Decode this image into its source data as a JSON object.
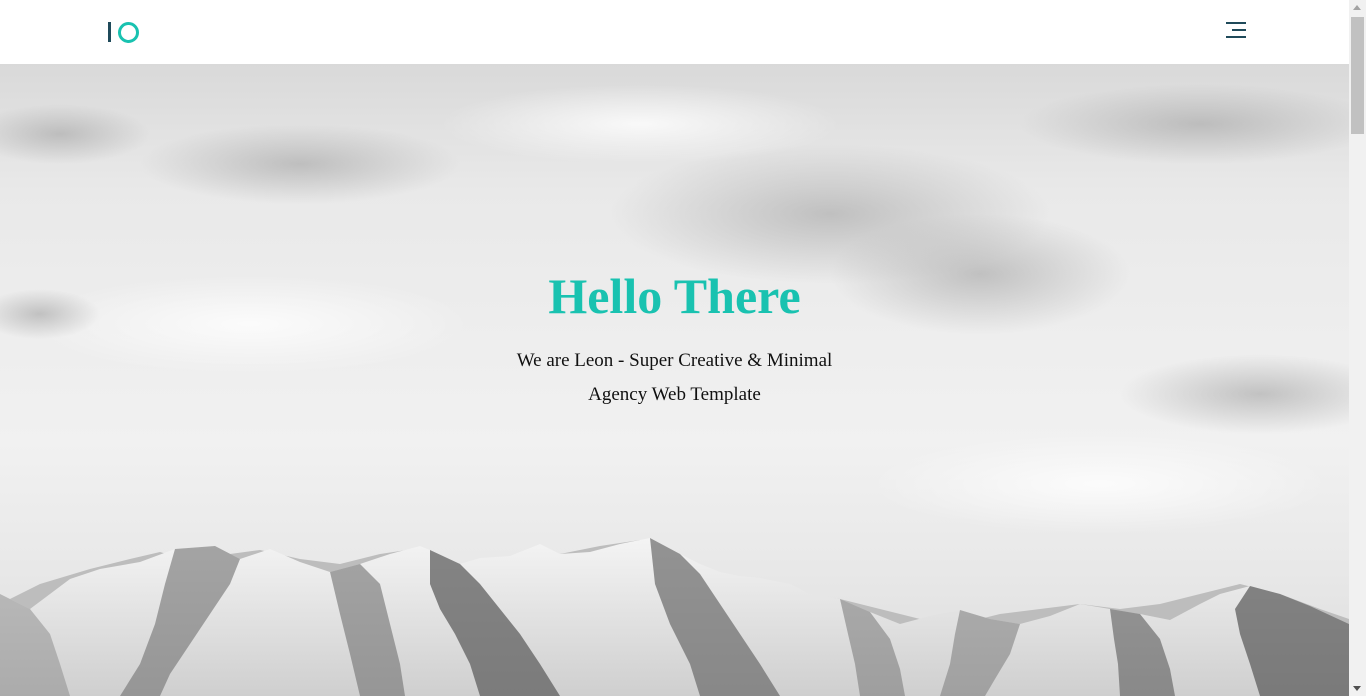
{
  "header": {
    "logo_icon": "io-logo-icon",
    "menu_icon": "hamburger-menu-icon"
  },
  "hero": {
    "title": "Hello There",
    "subtitle_line1": "We are Leon - Super Creative & Minimal",
    "subtitle_line2": "Agency Web Template",
    "background": "mountain-landscape-image"
  },
  "colors": {
    "accent": "#19c2b0",
    "logo_dark": "#1f4a5a",
    "text": "#111111"
  },
  "scrollbar": {
    "icon_up": "scroll-up-arrow-icon",
    "icon_down": "scroll-down-arrow-icon"
  }
}
